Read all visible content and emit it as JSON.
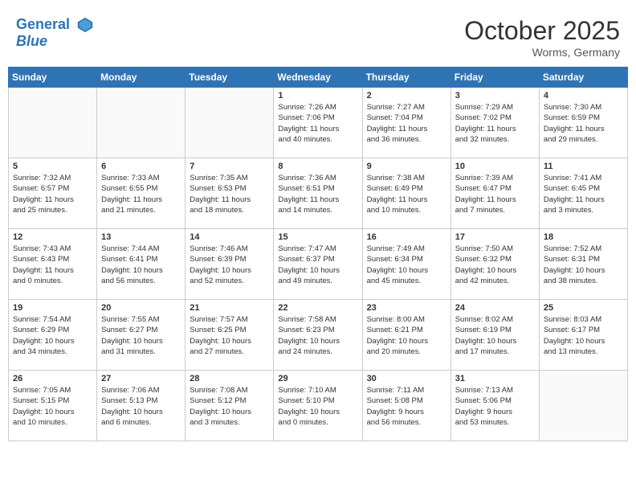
{
  "header": {
    "logo_line1": "General",
    "logo_line2": "Blue",
    "month": "October 2025",
    "location": "Worms, Germany"
  },
  "weekdays": [
    "Sunday",
    "Monday",
    "Tuesday",
    "Wednesday",
    "Thursday",
    "Friday",
    "Saturday"
  ],
  "weeks": [
    [
      {
        "day": "",
        "info": ""
      },
      {
        "day": "",
        "info": ""
      },
      {
        "day": "",
        "info": ""
      },
      {
        "day": "1",
        "info": "Sunrise: 7:26 AM\nSunset: 7:06 PM\nDaylight: 11 hours\nand 40 minutes."
      },
      {
        "day": "2",
        "info": "Sunrise: 7:27 AM\nSunset: 7:04 PM\nDaylight: 11 hours\nand 36 minutes."
      },
      {
        "day": "3",
        "info": "Sunrise: 7:29 AM\nSunset: 7:02 PM\nDaylight: 11 hours\nand 32 minutes."
      },
      {
        "day": "4",
        "info": "Sunrise: 7:30 AM\nSunset: 6:59 PM\nDaylight: 11 hours\nand 29 minutes."
      }
    ],
    [
      {
        "day": "5",
        "info": "Sunrise: 7:32 AM\nSunset: 6:57 PM\nDaylight: 11 hours\nand 25 minutes."
      },
      {
        "day": "6",
        "info": "Sunrise: 7:33 AM\nSunset: 6:55 PM\nDaylight: 11 hours\nand 21 minutes."
      },
      {
        "day": "7",
        "info": "Sunrise: 7:35 AM\nSunset: 6:53 PM\nDaylight: 11 hours\nand 18 minutes."
      },
      {
        "day": "8",
        "info": "Sunrise: 7:36 AM\nSunset: 6:51 PM\nDaylight: 11 hours\nand 14 minutes."
      },
      {
        "day": "9",
        "info": "Sunrise: 7:38 AM\nSunset: 6:49 PM\nDaylight: 11 hours\nand 10 minutes."
      },
      {
        "day": "10",
        "info": "Sunrise: 7:39 AM\nSunset: 6:47 PM\nDaylight: 11 hours\nand 7 minutes."
      },
      {
        "day": "11",
        "info": "Sunrise: 7:41 AM\nSunset: 6:45 PM\nDaylight: 11 hours\nand 3 minutes."
      }
    ],
    [
      {
        "day": "12",
        "info": "Sunrise: 7:43 AM\nSunset: 6:43 PM\nDaylight: 11 hours\nand 0 minutes."
      },
      {
        "day": "13",
        "info": "Sunrise: 7:44 AM\nSunset: 6:41 PM\nDaylight: 10 hours\nand 56 minutes."
      },
      {
        "day": "14",
        "info": "Sunrise: 7:46 AM\nSunset: 6:39 PM\nDaylight: 10 hours\nand 52 minutes."
      },
      {
        "day": "15",
        "info": "Sunrise: 7:47 AM\nSunset: 6:37 PM\nDaylight: 10 hours\nand 49 minutes."
      },
      {
        "day": "16",
        "info": "Sunrise: 7:49 AM\nSunset: 6:34 PM\nDaylight: 10 hours\nand 45 minutes."
      },
      {
        "day": "17",
        "info": "Sunrise: 7:50 AM\nSunset: 6:32 PM\nDaylight: 10 hours\nand 42 minutes."
      },
      {
        "day": "18",
        "info": "Sunrise: 7:52 AM\nSunset: 6:31 PM\nDaylight: 10 hours\nand 38 minutes."
      }
    ],
    [
      {
        "day": "19",
        "info": "Sunrise: 7:54 AM\nSunset: 6:29 PM\nDaylight: 10 hours\nand 34 minutes."
      },
      {
        "day": "20",
        "info": "Sunrise: 7:55 AM\nSunset: 6:27 PM\nDaylight: 10 hours\nand 31 minutes."
      },
      {
        "day": "21",
        "info": "Sunrise: 7:57 AM\nSunset: 6:25 PM\nDaylight: 10 hours\nand 27 minutes."
      },
      {
        "day": "22",
        "info": "Sunrise: 7:58 AM\nSunset: 6:23 PM\nDaylight: 10 hours\nand 24 minutes."
      },
      {
        "day": "23",
        "info": "Sunrise: 8:00 AM\nSunset: 6:21 PM\nDaylight: 10 hours\nand 20 minutes."
      },
      {
        "day": "24",
        "info": "Sunrise: 8:02 AM\nSunset: 6:19 PM\nDaylight: 10 hours\nand 17 minutes."
      },
      {
        "day": "25",
        "info": "Sunrise: 8:03 AM\nSunset: 6:17 PM\nDaylight: 10 hours\nand 13 minutes."
      }
    ],
    [
      {
        "day": "26",
        "info": "Sunrise: 7:05 AM\nSunset: 5:15 PM\nDaylight: 10 hours\nand 10 minutes."
      },
      {
        "day": "27",
        "info": "Sunrise: 7:06 AM\nSunset: 5:13 PM\nDaylight: 10 hours\nand 6 minutes."
      },
      {
        "day": "28",
        "info": "Sunrise: 7:08 AM\nSunset: 5:12 PM\nDaylight: 10 hours\nand 3 minutes."
      },
      {
        "day": "29",
        "info": "Sunrise: 7:10 AM\nSunset: 5:10 PM\nDaylight: 10 hours\nand 0 minutes."
      },
      {
        "day": "30",
        "info": "Sunrise: 7:11 AM\nSunset: 5:08 PM\nDaylight: 9 hours\nand 56 minutes."
      },
      {
        "day": "31",
        "info": "Sunrise: 7:13 AM\nSunset: 5:06 PM\nDaylight: 9 hours\nand 53 minutes."
      },
      {
        "day": "",
        "info": ""
      }
    ]
  ]
}
